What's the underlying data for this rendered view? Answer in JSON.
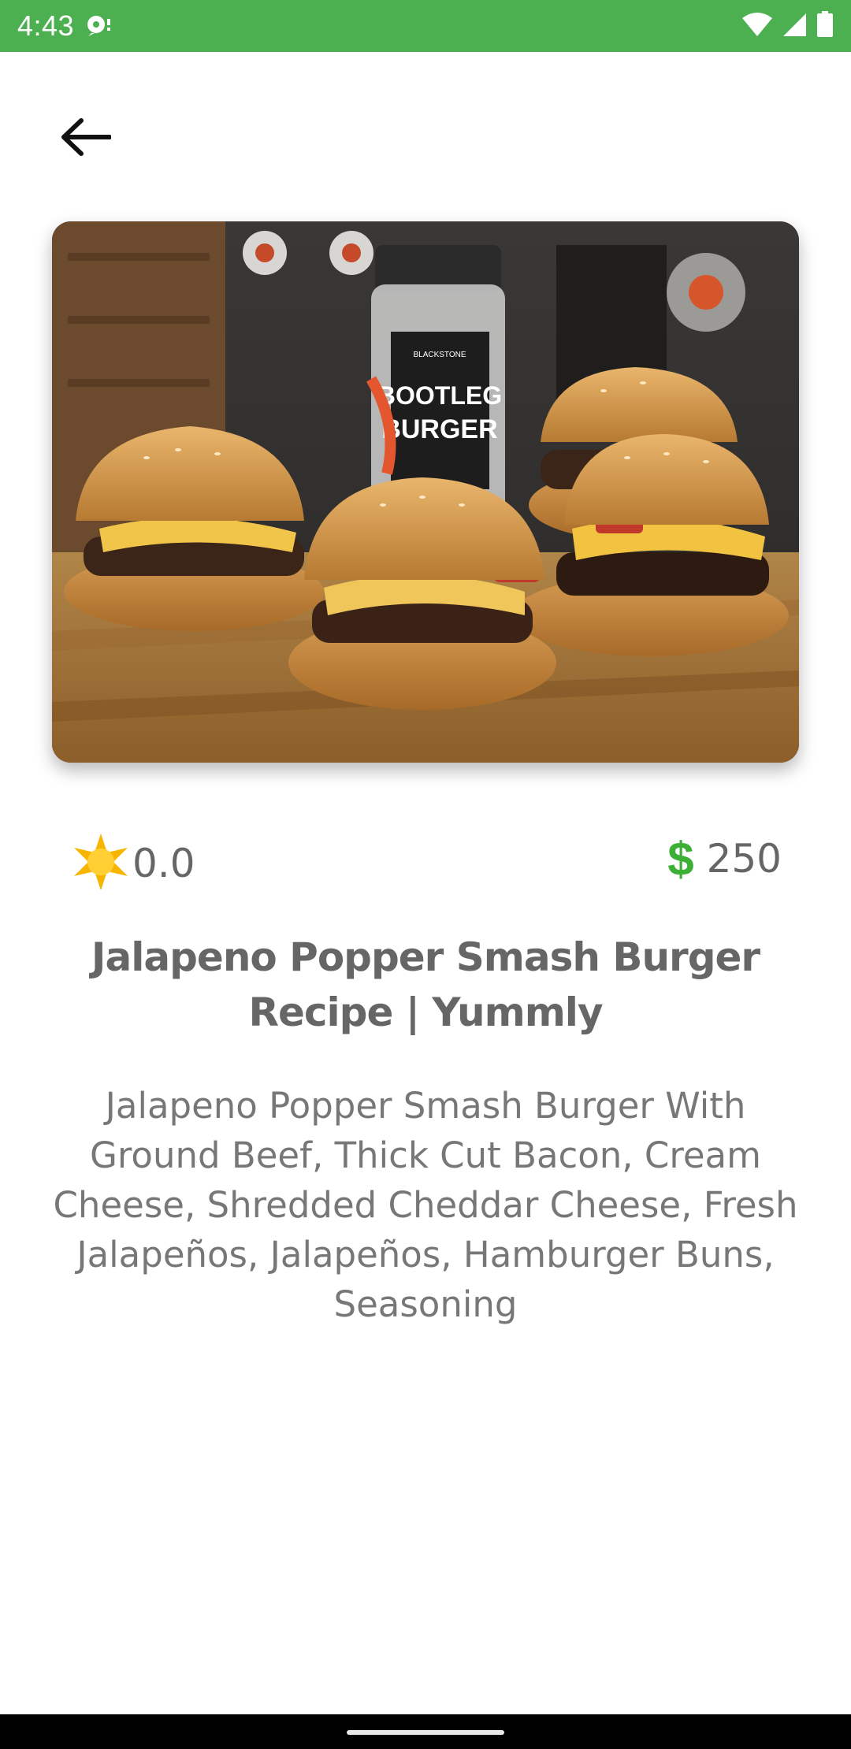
{
  "status_bar": {
    "time": "4:43",
    "background": "#4caf50"
  },
  "screen": {
    "back_icon": "arrow-left-icon"
  },
  "recipe": {
    "image_label_line1": "BOOTLEG",
    "image_label_line2": "BURGER",
    "image_brand": "BLACKSTONE",
    "rating": "0.0",
    "rating_icon": "star-icon",
    "price_symbol": "$",
    "price": "250",
    "title": "Jalapeno Popper Smash Burger Recipe | Yummly",
    "description": "Jalapeno Popper Smash Burger With Ground Beef, Thick Cut Bacon, Cream Cheese, Shredded Cheddar Cheese, Fresh Jalapeños, Jalapeños, Hamburger Buns, Seasoning"
  },
  "colors": {
    "accent": "#3cb034",
    "text": "#666666",
    "star": "#f7b500"
  }
}
